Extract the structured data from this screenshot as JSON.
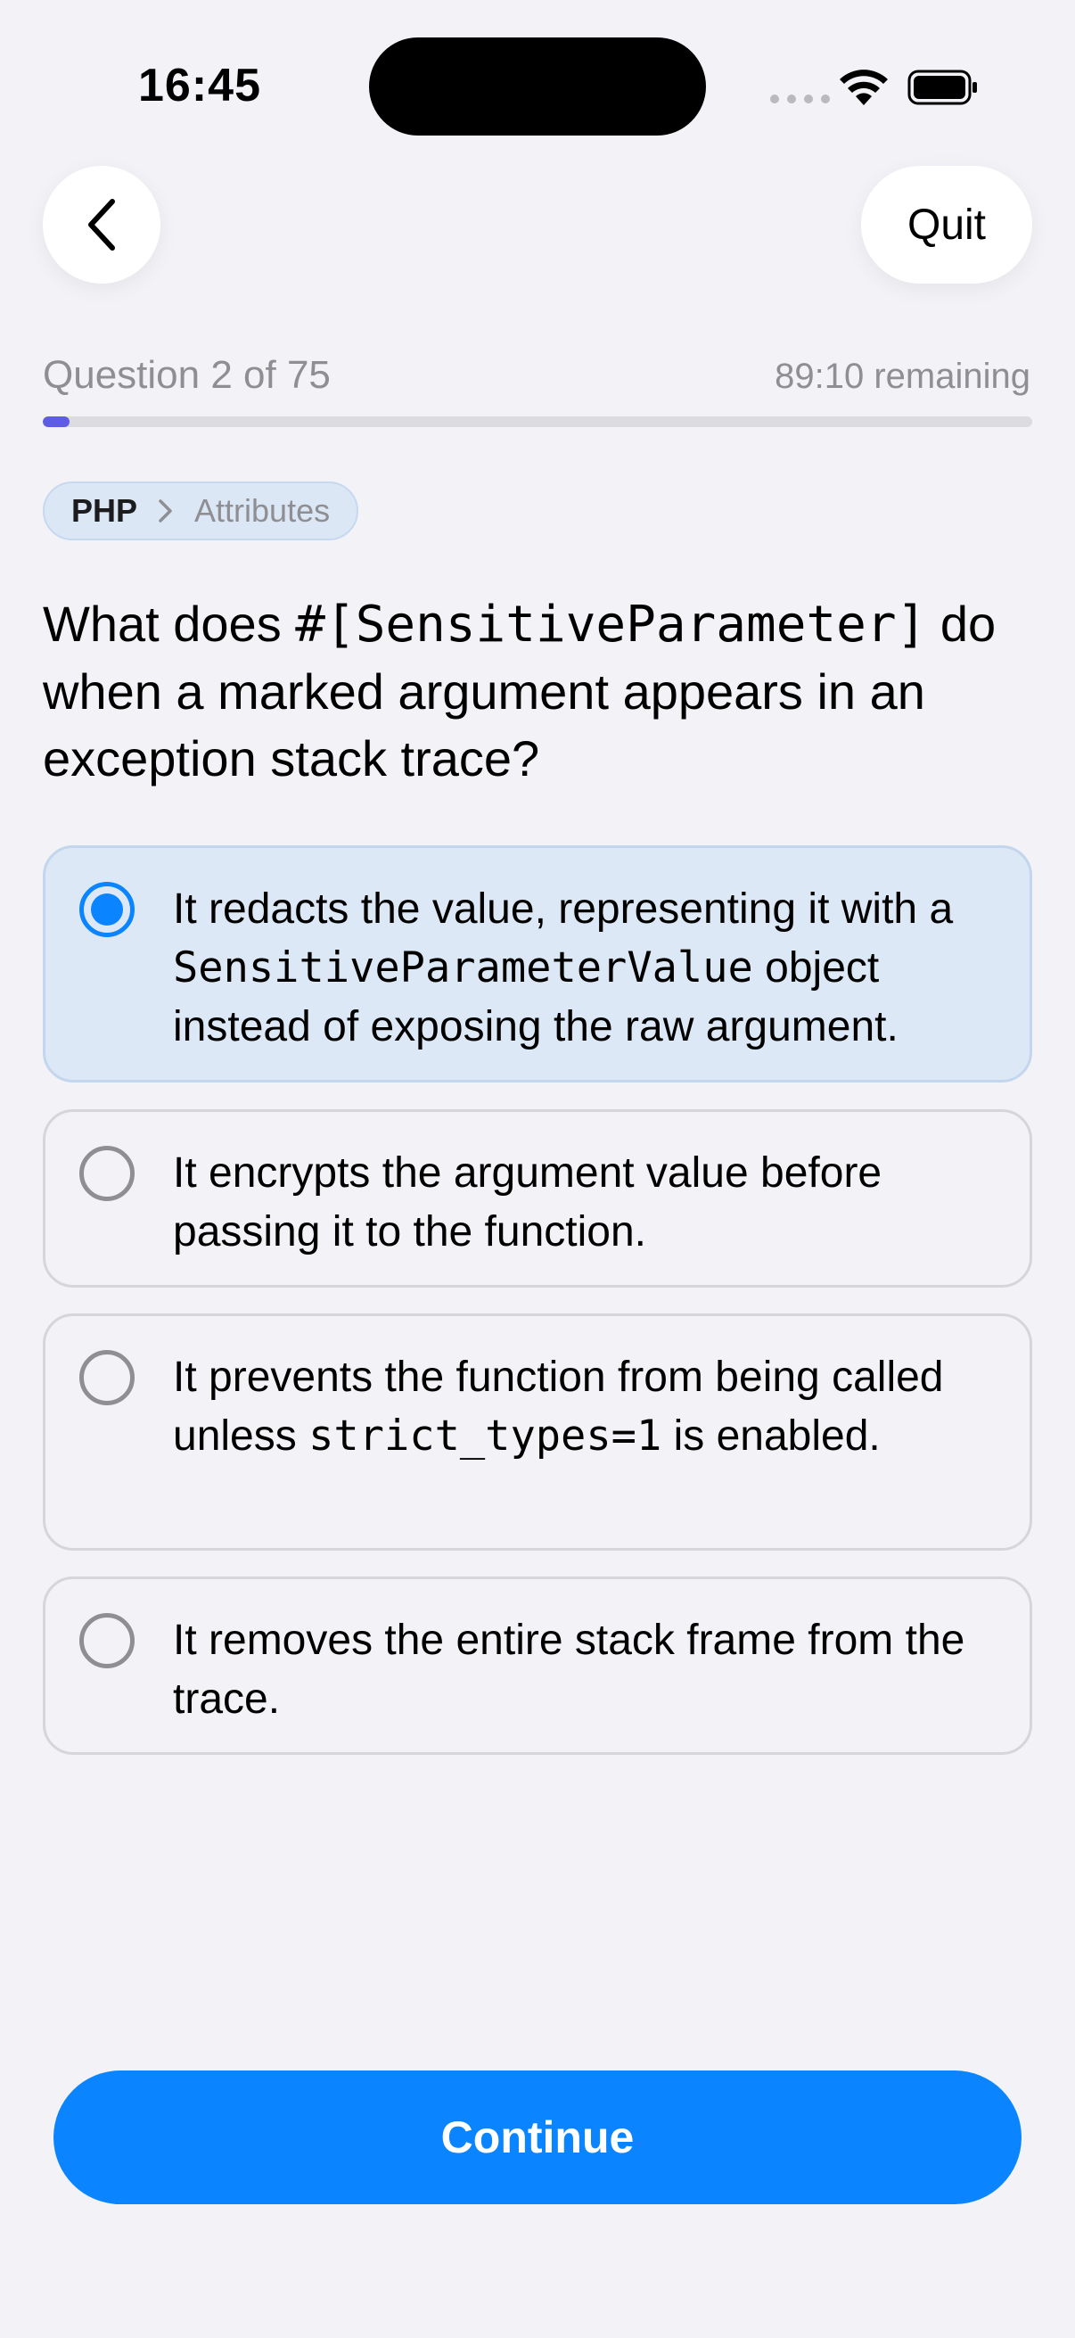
{
  "status_bar": {
    "time": "16:45"
  },
  "header": {
    "back_icon": "chevron-left-icon",
    "quit_label": "Quit"
  },
  "progress": {
    "question_label": "Question 2 of 75",
    "remaining_label": "89:10 remaining",
    "fraction": 0.027,
    "color": "#5e5ce6"
  },
  "breadcrumb": {
    "topic": "PHP",
    "separator_icon": "chevron-right-icon",
    "subtopic": "Attributes"
  },
  "question": {
    "prefix": "What does ",
    "code": "#[SensitiveParameter]",
    "suffix": " do when a marked argument appears in an exception stack trace?"
  },
  "options": [
    {
      "before": "It redacts the value, representing it with a ",
      "code": "SensitiveParameterValue",
      "after": " object instead of exposing the raw argument.",
      "selected": true
    },
    {
      "before": "It encrypts the argument value before passing it to the function.",
      "code": "",
      "after": "",
      "selected": false
    },
    {
      "before": "It prevents the function from being called unless ",
      "code": "strict_types=1",
      "after": " is enabled.",
      "selected": false
    },
    {
      "before": "It removes the entire stack frame from the trace.",
      "code": "",
      "after": "",
      "selected": false
    }
  ],
  "footer": {
    "continue_label": "Continue"
  },
  "colors": {
    "accent": "#0a84ff",
    "selected_bg": "#dce8f6",
    "background": "#f2f2f7"
  }
}
